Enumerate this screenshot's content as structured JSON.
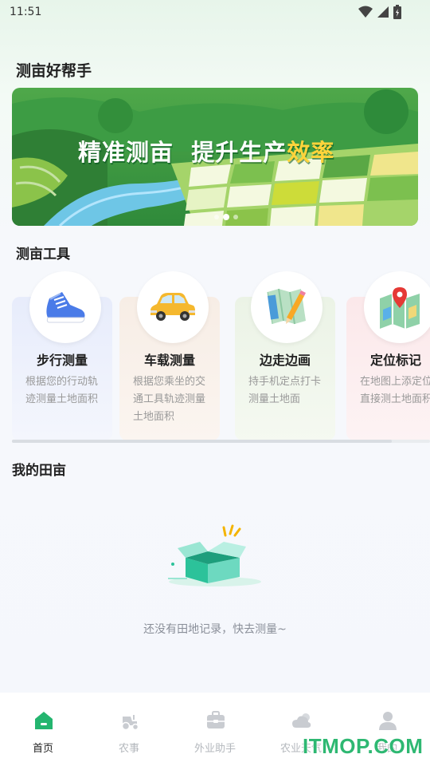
{
  "status_bar": {
    "time": "11:51"
  },
  "app_title": "测亩好帮手",
  "banner": {
    "headline_part1": "精准测亩",
    "headline_part2": "提升生产",
    "headline_highlight": "效率",
    "slide_count": 3,
    "active_slide": 2
  },
  "tools": {
    "title": "测亩工具",
    "items": [
      {
        "name": "步行测量",
        "desc": "根据您的行动轨迹测量土地面积",
        "icon": "sneaker-icon"
      },
      {
        "name": "车载测量",
        "desc": "根据您乘坐的交通工具轨迹测量土地面积",
        "icon": "car-icon"
      },
      {
        "name": "边走边画",
        "desc": "持手机定点打卡测量土地面",
        "icon": "map-pencil-icon"
      },
      {
        "name": "定位标记",
        "desc": "在地图上添定位直接测土地面积",
        "icon": "map-pin-icon"
      }
    ]
  },
  "fields": {
    "title": "我的田亩",
    "empty_text": "还没有田地记录，快去测量~"
  },
  "tab_bar": {
    "items": [
      {
        "label": "首页",
        "icon": "home-icon",
        "active": true
      },
      {
        "label": "农事",
        "icon": "tractor-icon",
        "active": false
      },
      {
        "label": "外业助手",
        "icon": "toolbox-icon",
        "active": false
      },
      {
        "label": "农业天气",
        "icon": "cloud-icon",
        "active": false
      },
      {
        "label": "我的",
        "icon": "user-icon",
        "active": false
      }
    ]
  },
  "watermark": "ITMOP.COM",
  "colors": {
    "accent": "#24b56f",
    "banner_green": "#3e9a3c",
    "highlight_yellow": "#ffd43b"
  }
}
